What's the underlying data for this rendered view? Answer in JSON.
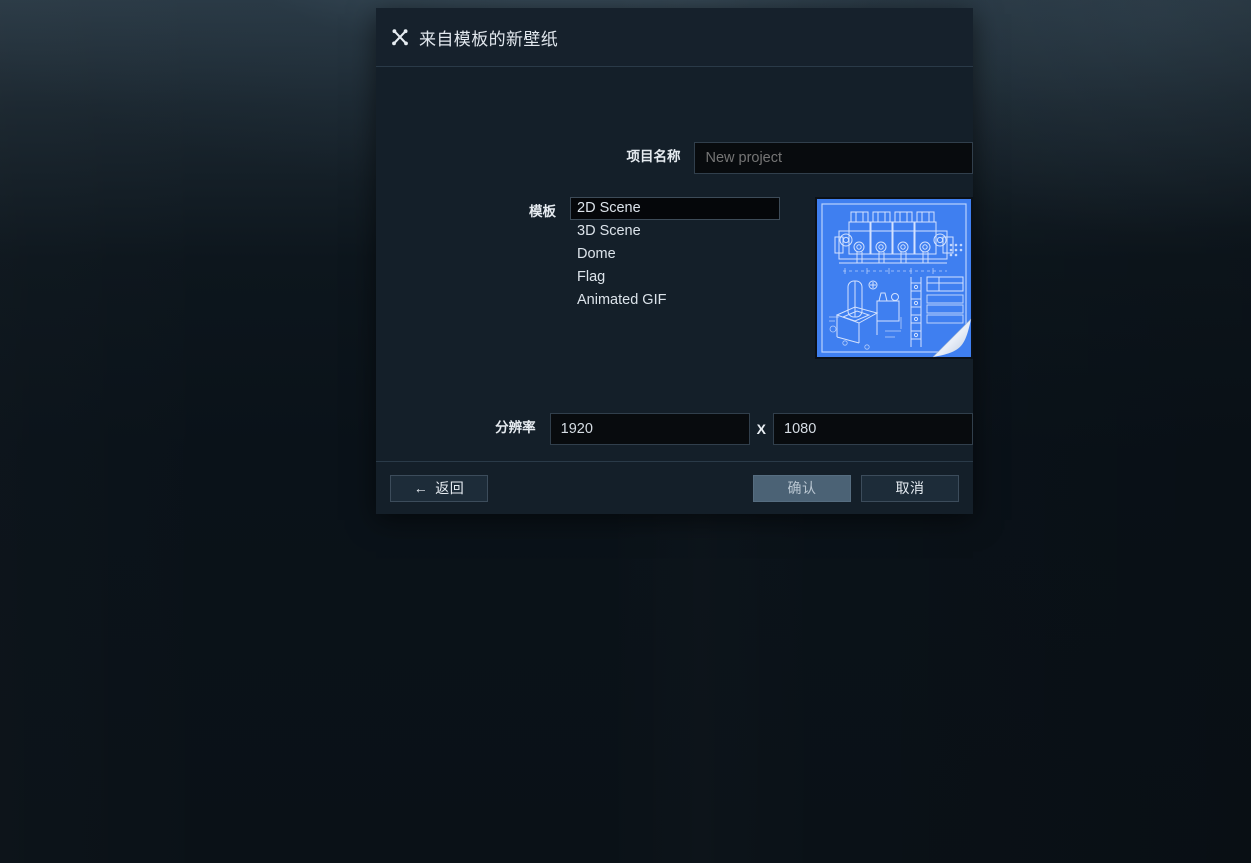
{
  "dialog": {
    "title": "来自模板的新壁纸",
    "title_icon": "tools-wand-icon",
    "fields": {
      "project_name_label": "项目名称",
      "project_name_value": "",
      "project_name_placeholder": "New project",
      "template_label": "模板",
      "resolution_label": "分辨率",
      "resolution_width": "1920",
      "resolution_separator": "X",
      "resolution_height": "1080"
    },
    "templates": [
      {
        "label": "2D Scene",
        "selected": true
      },
      {
        "label": "3D Scene",
        "selected": false
      },
      {
        "label": "Dome",
        "selected": false
      },
      {
        "label": "Flag",
        "selected": false
      },
      {
        "label": "Animated GIF",
        "selected": false
      }
    ],
    "preview": {
      "name": "blueprint-thumbnail",
      "description": "蓝图技术图纸缩略图，右下角卷角",
      "paper_color": "#3f7ff0",
      "line_color": "#cfe0ff"
    },
    "buttons": {
      "back_arrow": "←",
      "back": "返回",
      "confirm": "确认",
      "cancel": "取消"
    }
  },
  "colors": {
    "dialog_bg": "#141f29",
    "titlebar_bg": "#16212c",
    "input_bg": "#080b0e",
    "border": "#2a3a48",
    "primary_button": "#4b6275",
    "text": "#e2e8ee",
    "placeholder_text": "#7d878f"
  }
}
